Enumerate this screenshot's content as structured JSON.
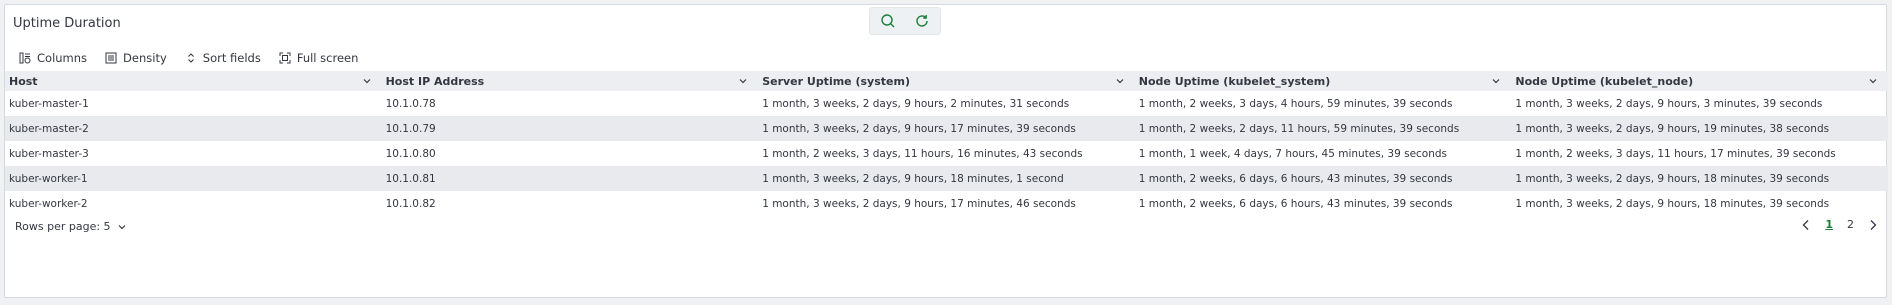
{
  "panel": {
    "title": "Uptime Duration"
  },
  "hover_actions": [
    {
      "icon": "zoom-icon"
    },
    {
      "icon": "refresh-icon"
    }
  ],
  "toolbar": {
    "columns_label": "Columns",
    "density_label": "Density",
    "sort_label": "Sort fields",
    "fullscreen_label": "Full screen"
  },
  "table": {
    "headers": [
      "Host",
      "Host IP Address",
      "Server Uptime (system)",
      "Node Uptime (kubelet_system)",
      "Node Uptime (kubelet_node)"
    ],
    "rows": [
      [
        "kuber-master-1",
        "10.1.0.78",
        "1 month, 3 weeks, 2 days, 9 hours, 2 minutes, 31 seconds",
        "1 month, 2 weeks, 3 days, 4 hours, 59 minutes, 39 seconds",
        "1 month, 3 weeks, 2 days, 9 hours, 3 minutes, 39 seconds"
      ],
      [
        "kuber-master-2",
        "10.1.0.79",
        "1 month, 3 weeks, 2 days, 9 hours, 17 minutes, 39 seconds",
        "1 month, 2 weeks, 2 days, 11 hours, 59 minutes, 39 seconds",
        "1 month, 3 weeks, 2 days, 9 hours, 19 minutes, 38 seconds"
      ],
      [
        "kuber-master-3",
        "10.1.0.80",
        "1 month, 2 weeks, 3 days, 11 hours, 16 minutes, 43 seconds",
        "1 month, 1 week, 4 days, 7 hours, 45 minutes, 39 seconds",
        "1 month, 2 weeks, 3 days, 11 hours, 17 minutes, 39 seconds"
      ],
      [
        "kuber-worker-1",
        "10.1.0.81",
        "1 month, 3 weeks, 2 days, 9 hours, 18 minutes, 1 second",
        "1 month, 2 weeks, 6 days, 6 hours, 43 minutes, 39 seconds",
        "1 month, 3 weeks, 2 days, 9 hours, 18 minutes, 39 seconds"
      ],
      [
        "kuber-worker-2",
        "10.1.0.82",
        "1 month, 3 weeks, 2 days, 9 hours, 17 minutes, 46 seconds",
        "1 month, 2 weeks, 6 days, 6 hours, 43 minutes, 39 seconds",
        "1 month, 3 weeks, 2 days, 9 hours, 18 minutes, 39 seconds"
      ]
    ]
  },
  "footer": {
    "rows_per_page_label": "Rows per page: 5",
    "pages": [
      "1",
      "2"
    ],
    "current_page": "1"
  },
  "colors": {
    "accent": "#006bb8",
    "current_page": "#1b7f3a",
    "row_shade": "#e8eaed",
    "header_bg": "#eceef1"
  }
}
